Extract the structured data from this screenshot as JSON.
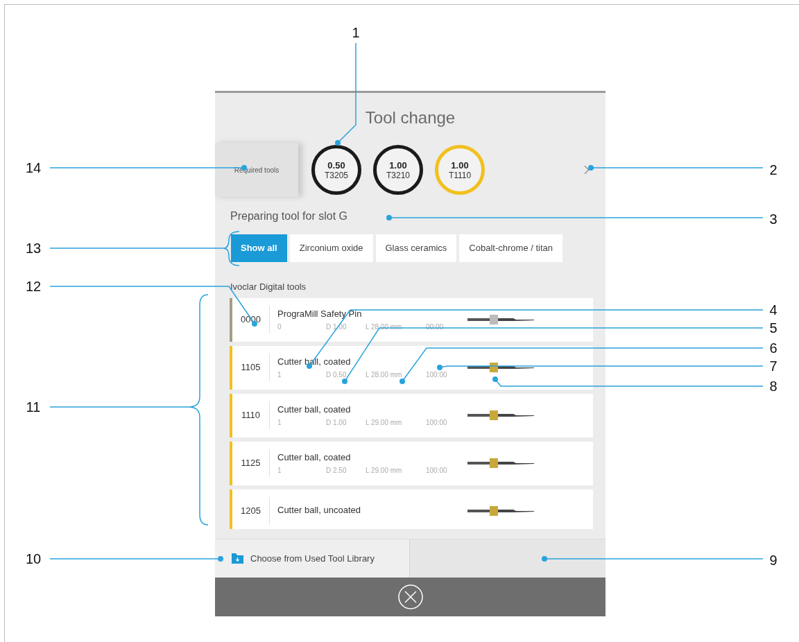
{
  "screen": {
    "title": "Tool change",
    "required_tools_label": "Required tools",
    "required_tools": [
      {
        "diameter": "0.50",
        "code": "T3205",
        "color": "#1a1a1a"
      },
      {
        "diameter": "1.00",
        "code": "T3210",
        "color": "#1a1a1a"
      },
      {
        "diameter": "1.00",
        "code": "T1110",
        "color": "#f2c01e"
      }
    ],
    "slot_label": "Preparing tool for slot G",
    "filters": [
      {
        "label": "Show all",
        "selected": true
      },
      {
        "label": "Zirconium oxide",
        "selected": false
      },
      {
        "label": "Glass ceramics",
        "selected": false
      },
      {
        "label": "Cobalt-chrome / titan",
        "selected": false
      }
    ],
    "section_title": "Ivoclar Digital tools",
    "tools": [
      {
        "number": "0000",
        "name": "PrograMill Safety Pin",
        "details": [
          "0",
          "D 1.00",
          "L 28.00 mm",
          "00:00"
        ],
        "color": "#a39e84"
      },
      {
        "number": "1105",
        "name": "Cutter ball, coated",
        "details": [
          "1",
          "D 0.50",
          "L 28.00 mm",
          "100:00"
        ],
        "color": "#f2c01e"
      },
      {
        "number": "1110",
        "name": "Cutter ball, coated",
        "details": [
          "1",
          "D 1.00",
          "L 29.00 mm",
          "100:00"
        ],
        "color": "#f2c01e"
      },
      {
        "number": "1125",
        "name": "Cutter ball, coated",
        "details": [
          "1",
          "D 2.50",
          "L 29.00 mm",
          "100:00"
        ],
        "color": "#f2c01e"
      },
      {
        "number": "1205",
        "name": "Cutter ball, uncoated",
        "color": "#f2c01e"
      }
    ],
    "library_button": "Choose from Used Tool Library"
  },
  "callouts": [
    "1",
    "14",
    "2",
    "3",
    "13",
    "12",
    "4",
    "5",
    "6",
    "7",
    "8",
    "11",
    "10",
    "9"
  ]
}
